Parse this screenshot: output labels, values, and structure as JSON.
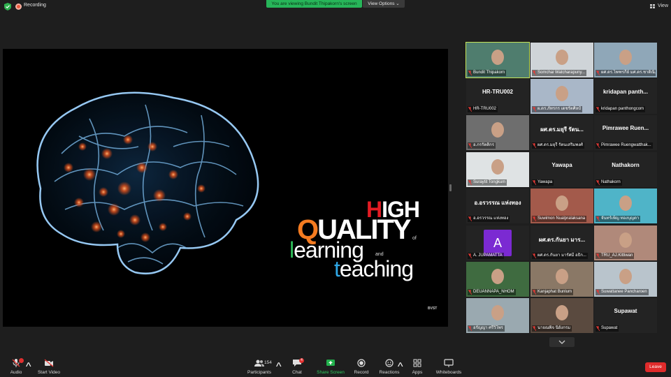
{
  "recording": {
    "label": "Recording"
  },
  "banner": {
    "prefix": "You are viewing Bundit Thipakorn's screen",
    "view_options": "View Options ⌄"
  },
  "view_button": {
    "label": "View"
  },
  "slide": {
    "high_1": "H",
    "high_2": "IGH",
    "quality_1": "Q",
    "quality_2": "UALITY",
    "of": "of",
    "learning_1": "l",
    "learning_2": "earning",
    "and": "and",
    "teaching_1": "t",
    "teaching_2": "eaching",
    "brand": "BVST"
  },
  "participants": [
    {
      "name": "Bundit Thipakorn",
      "big": "",
      "kind": "video",
      "color": "#4f7d6e",
      "active": true
    },
    {
      "name": "Somchai Watcharapuny...",
      "big": "",
      "kind": "video",
      "color": "#cfd4d8"
    },
    {
      "name": "ผศ.ดร.ไพฑรกีย์ มศ.ดร.ชาติณิ...",
      "big": "",
      "kind": "video",
      "color": "#8fa7b8"
    },
    {
      "name": "HR-TRU002",
      "big": "HR-TRU002",
      "kind": "text"
    },
    {
      "name": "ผ.ดร.ภัทรกร เดชรัตศิลป์",
      "big": "",
      "kind": "video",
      "color": "#a9b7c8"
    },
    {
      "name": "kridapan panthongcom",
      "big": "kridapan  panth...",
      "kind": "text"
    },
    {
      "name": "อ.กรรัตติกร",
      "big": "",
      "kind": "video",
      "color": "#6e6e6e"
    },
    {
      "name": "ผศ.ดร.มยุรี รัตนเสริมพงศ์",
      "big": "ผศ.ดร.มยุรี รัตน...",
      "kind": "text"
    },
    {
      "name": "Pimrawee Ruengwatthak...",
      "big": "Pimrawee  Ruen...",
      "kind": "text"
    },
    {
      "name": "Suraytit Tongkum",
      "big": "",
      "kind": "video",
      "color": "#dfe3e4"
    },
    {
      "name": "Yawapa",
      "big": "Yawapa",
      "kind": "text"
    },
    {
      "name": "Nathakorn",
      "big": "Nathakorn",
      "kind": "text"
    },
    {
      "name": "อ.อรวรรณ แห่งทอง",
      "big": "อ.อรวรรณ แห่งทอง",
      "kind": "text"
    },
    {
      "name": "Suwimon Nualpralaksana",
      "big": "",
      "kind": "video",
      "color": "#a35a4b"
    },
    {
      "name": "จันทร์เพ็ญ ทองบุญตา",
      "big": "",
      "kind": "video",
      "color": "#4fb4c8"
    },
    {
      "name": "A. JUPAMATTA",
      "big": "A",
      "kind": "avatar"
    },
    {
      "name": "ผศ.ดร.กันยา มารัศมี อธิก...",
      "big": "ผศ.ดร.กันยา มาร...",
      "kind": "text"
    },
    {
      "name": "TRU_AJ.Kittiwan",
      "big": "",
      "kind": "video",
      "color": "#b0897a"
    },
    {
      "name": "DEUANNAPA_NHOM",
      "big": "",
      "kind": "video",
      "color": "#3f6b40"
    },
    {
      "name": "Kanjaphat Bunlum",
      "big": "",
      "kind": "video",
      "color": "#8a7866"
    },
    {
      "name": "Suwattanee Pancharoen",
      "big": "",
      "kind": "video",
      "color": "#b9c4cc"
    },
    {
      "name": "อรัญญา ศรีวิโพร",
      "big": "",
      "kind": "video",
      "color": "#9aa9b0"
    },
    {
      "name": "นายณพิจ นิยังกรม",
      "big": "",
      "kind": "video",
      "color": "#5a4a3f"
    },
    {
      "name": "Supawat",
      "big": "Supawat",
      "kind": "text"
    }
  ],
  "toolbar": {
    "audio": "Audio",
    "start_video": "Start Video",
    "participants": "Participants",
    "participants_count": "154",
    "chat": "Chat",
    "chat_badge": "4",
    "share_screen": "Share Screen",
    "record": "Record",
    "reactions": "Reactions",
    "apps": "Apps",
    "whiteboards": "Whiteboards",
    "leave": "Leave"
  }
}
